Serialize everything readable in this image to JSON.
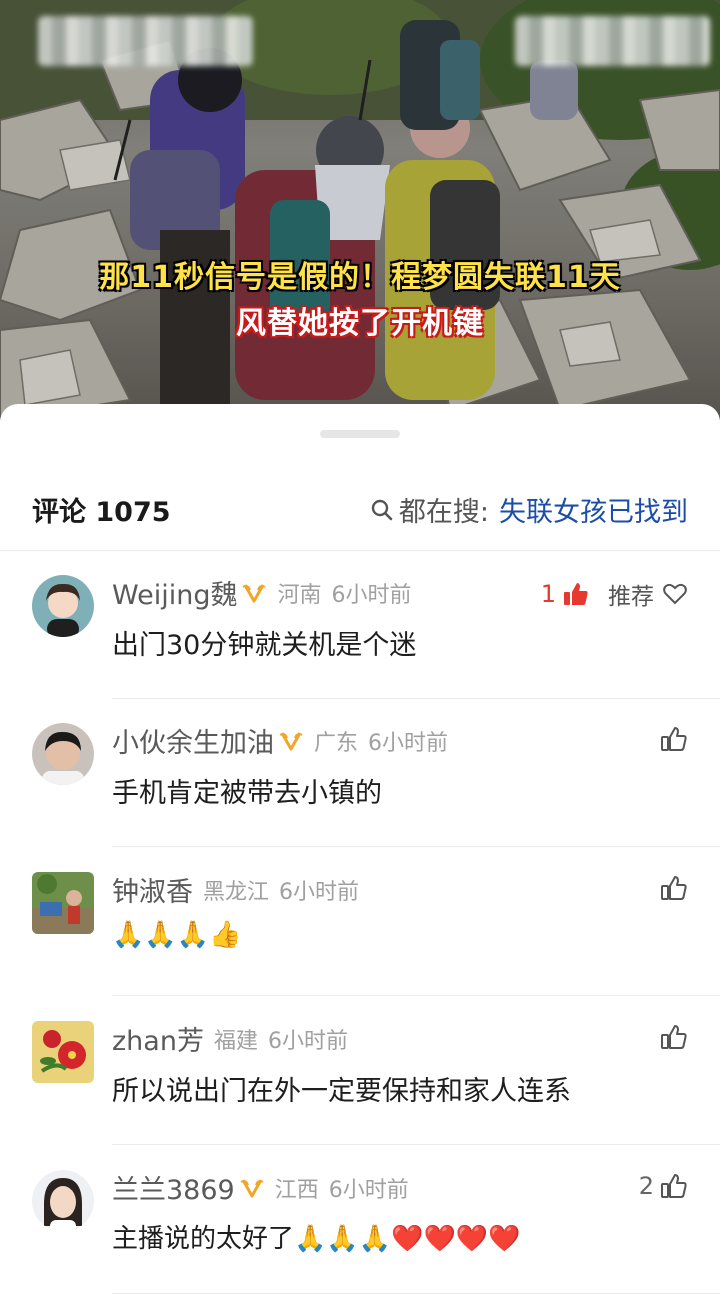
{
  "video": {
    "caption_line1": "那11秒信号是假的！程梦圆失联11天",
    "caption_line2": "风替她按了开机键"
  },
  "header": {
    "comments_label": "评论 1075",
    "search_label": "都在搜:",
    "search_topic": "失联女孩已找到"
  },
  "comments": [
    {
      "user": "Weijing魏",
      "location": "河南",
      "time": "6小时前",
      "text": "出门30分钟就关机是个迷",
      "likes": "1",
      "recommend_label": "推荐",
      "verified": true
    },
    {
      "user": "小伙余生加油",
      "location": "广东",
      "time": "6小时前",
      "text": "手机肯定被带去小镇的",
      "likes": "",
      "verified": true
    },
    {
      "user": "钟淑香",
      "location": "黑龙江",
      "time": "6小时前",
      "text": "🙏🙏🙏👍",
      "likes": "",
      "verified": false
    },
    {
      "user": "zhan芳",
      "location": "福建",
      "time": "6小时前",
      "text": "所以说出门在外一定要保持和家人连系",
      "likes": "",
      "verified": false
    },
    {
      "user": "兰兰3869",
      "location": "江西",
      "time": "6小时前",
      "text": "主播说的太好了🙏🙏🙏❤️❤️❤️❤️",
      "likes": "2",
      "verified": true
    }
  ],
  "colors": {
    "accent_red": "#e6392f",
    "topic_blue": "#1c4ea8",
    "badge_gold": "#f2a626"
  }
}
